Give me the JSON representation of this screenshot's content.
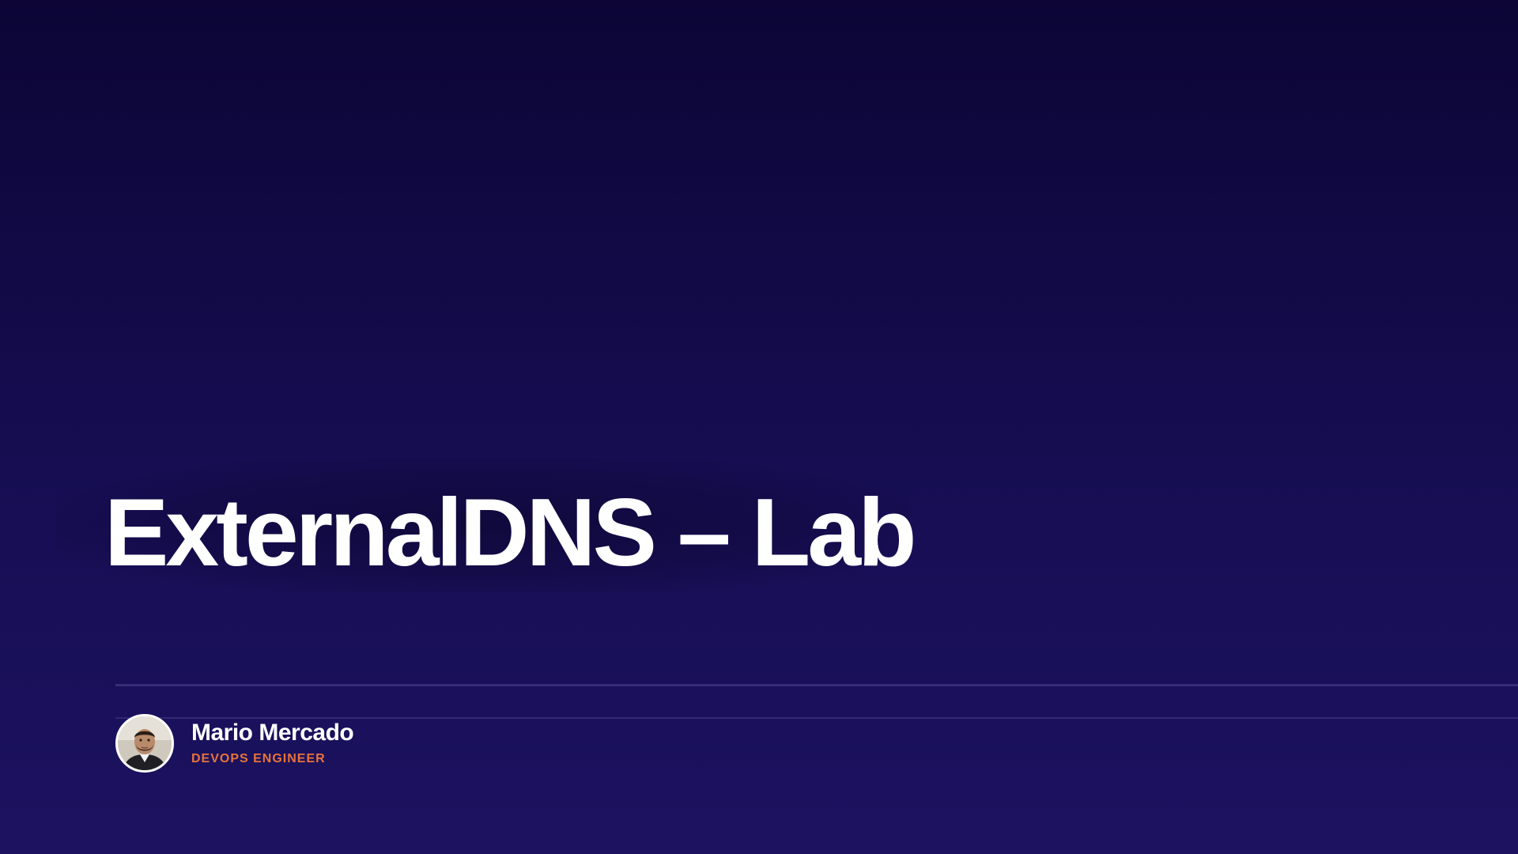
{
  "slide": {
    "title": "ExternalDNS – Lab"
  },
  "presenter": {
    "name": "Mario Mercado",
    "role": "DEVOPS ENGINEER",
    "avatar_icon": "person-photo"
  },
  "colors": {
    "background_top": "#0c0536",
    "background_bottom": "#1c1260",
    "title": "#ffffff",
    "role_accent": "#e8733a"
  }
}
